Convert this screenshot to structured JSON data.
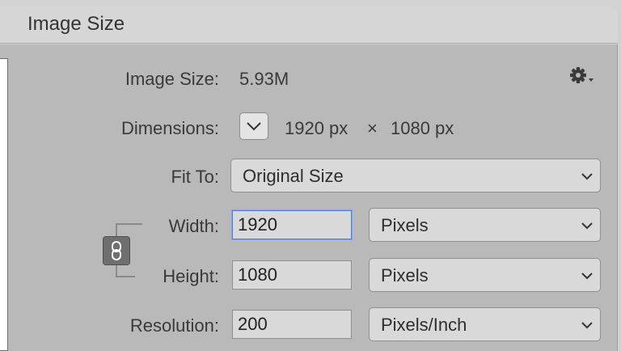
{
  "window": {
    "title": "Image Size"
  },
  "image_size": {
    "label": "Image Size:",
    "value": "5.93M"
  },
  "settings_icon": "gear-icon",
  "dimensions": {
    "label": "Dimensions:",
    "width": "1920 px",
    "separator": "×",
    "height": "1080 px"
  },
  "fit_to": {
    "label": "Fit To:",
    "value": "Original Size"
  },
  "width": {
    "label": "Width:",
    "value": "1920",
    "unit": "Pixels"
  },
  "height": {
    "label": "Height:",
    "value": "1080",
    "unit": "Pixels"
  },
  "resolution": {
    "label": "Resolution:",
    "value": "200",
    "unit": "Pixels/Inch"
  },
  "constrain": {
    "icon": "chain-link-icon",
    "linked": true
  },
  "colors": {
    "focus": "#4d7fd6",
    "panel": "#b9b9b9",
    "field": "#d9d9d9"
  }
}
